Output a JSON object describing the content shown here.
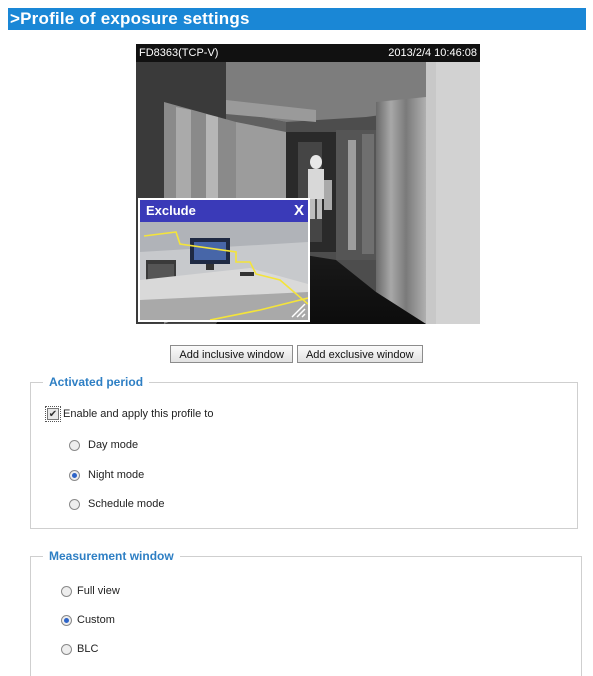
{
  "header": {
    "title": ">Profile of exposure settings"
  },
  "viewer": {
    "camera_name": "FD8363(TCP-V)",
    "timestamp": "2013/2/4 10:46:08",
    "exclude_window": {
      "title": "Exclude",
      "close_label": "X"
    }
  },
  "buttons": {
    "add_inclusive": "Add inclusive window",
    "add_exclusive": "Add exclusive window"
  },
  "activated_period": {
    "legend": "Activated period",
    "enable_label": "Enable and apply this profile to",
    "enable_checked": true,
    "modes": [
      "Day mode",
      "Night mode",
      "Schedule mode"
    ],
    "selected_mode": "Night mode"
  },
  "measurement_window": {
    "legend": "Measurement window",
    "options": [
      "Full view",
      "Custom",
      "BLC"
    ],
    "selected": "Custom"
  }
}
